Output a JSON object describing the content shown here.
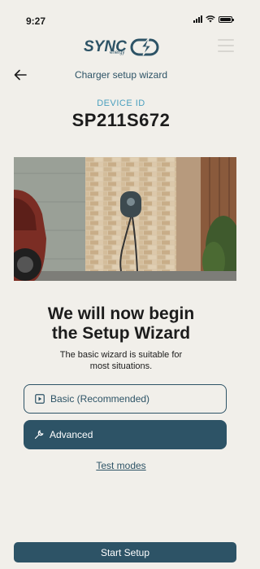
{
  "status_bar": {
    "time": "9:27"
  },
  "brand": {
    "logo_text": "SYNC",
    "logo_sub": "energy"
  },
  "header": {
    "title": "Charger setup wizard"
  },
  "device": {
    "label": "DEVICE ID",
    "id": "SP211S672"
  },
  "main": {
    "headline_line1": "We will now begin",
    "headline_line2": "the Setup Wizard",
    "subtext_line1": "The basic wizard is suitable for",
    "subtext_line2": "most situations."
  },
  "options": {
    "basic_label": "Basic (Recommended)",
    "advanced_label": "Advanced"
  },
  "links": {
    "test_modes": "Test modes"
  },
  "actions": {
    "start_setup": "Start Setup"
  },
  "colors": {
    "accent": "#2d5366",
    "device_label": "#4a9fbe",
    "background": "#f1efea"
  }
}
